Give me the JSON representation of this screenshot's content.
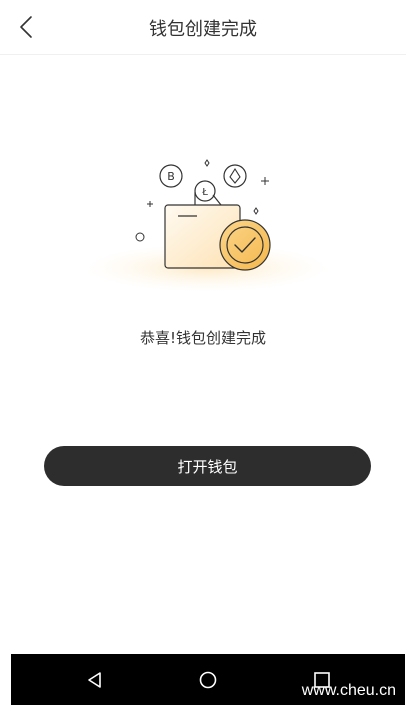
{
  "header": {
    "title": "钱包创建完成",
    "back_icon": "chevron-left-icon"
  },
  "success": {
    "message": "恭喜!钱包创建完成",
    "illustration": "wallet-success-illustration"
  },
  "actions": {
    "open_wallet_label": "打开钱包"
  },
  "system_nav": {
    "back_icon": "triangle-back-icon",
    "home_icon": "circle-home-icon",
    "recents_icon": "square-recents-icon"
  },
  "watermark": {
    "text": "www.cheu.cn"
  },
  "colors": {
    "accent": "#f5b84c",
    "button_bg": "#2d2d2d",
    "nav_bg": "#000000"
  }
}
